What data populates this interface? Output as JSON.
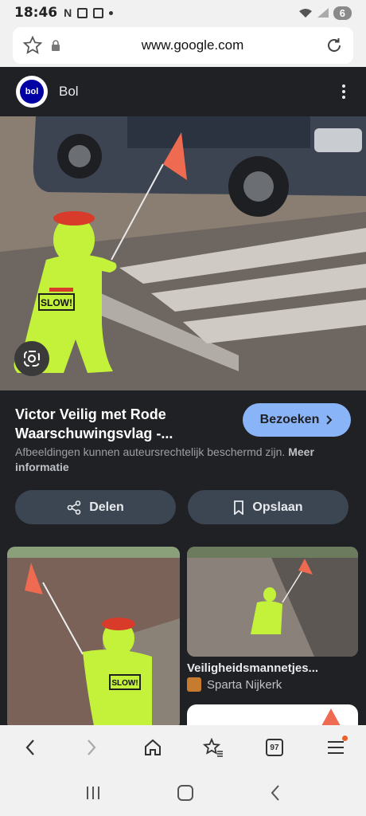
{
  "status_bar": {
    "time": "18:46",
    "battery": "6"
  },
  "browser": {
    "url": "www.google.com"
  },
  "site": {
    "logo_text": "bol",
    "name": "Bol"
  },
  "hero_image": {
    "sign_text": "SLOW!"
  },
  "result": {
    "title": "Victor Veilig met Rode Waarschuwingsvlag -...",
    "visit_label": "Bezoeken",
    "notice": "Afbeeldingen kunnen auteursrechtelijk beschermd zijn.",
    "notice_more": "Meer informatie",
    "share_label": "Delen",
    "save_label": "Opslaan"
  },
  "related": {
    "right_title": "Veiligheidsmannetjes...",
    "right_source": "Sparta Nijkerk"
  },
  "toolbar": {
    "tabs_count": "97"
  },
  "colors": {
    "accent_button": "#8ab4f8",
    "dark_bg": "#202124",
    "action_btn_bg": "#3c4653",
    "toy_green": "#c4f23a",
    "flag_red": "#ee6a50"
  }
}
